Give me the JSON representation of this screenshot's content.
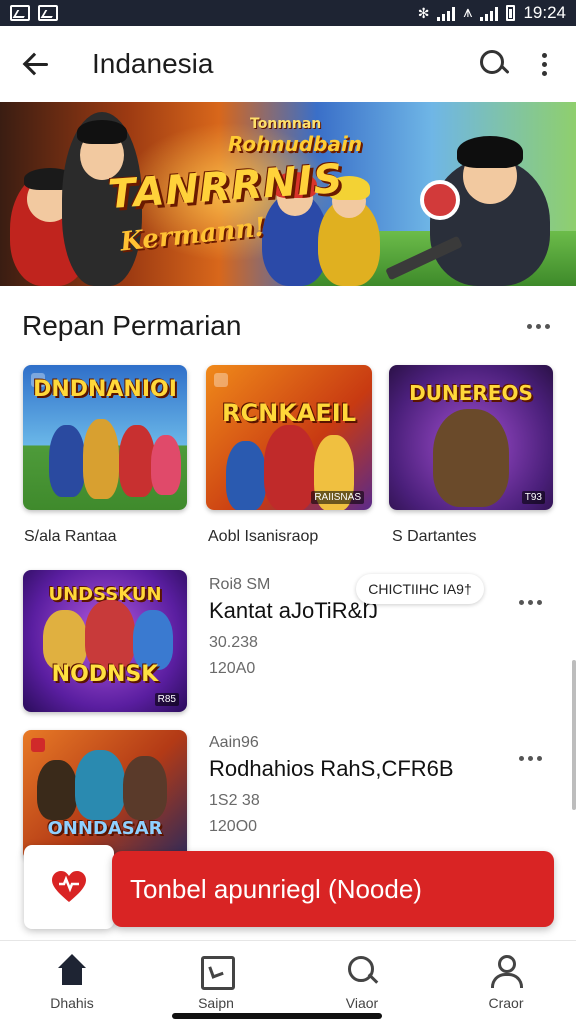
{
  "status_bar": {
    "time": "19:24"
  },
  "app_bar": {
    "title": "Indanesia"
  },
  "banner": {
    "line1": "Tonmnan",
    "line2": "Rohnudbain",
    "title": "TANRRNIS",
    "subtitle": "Kermann!"
  },
  "section": {
    "title": "Repan Permarian"
  },
  "grid": [
    {
      "thumb_title": "DNDNANIOI",
      "caption": "S/ala Rantaa"
    },
    {
      "thumb_title": "RCNKAEIL",
      "caption": "Aobl Isanisraop",
      "badge": "RAIISNAS"
    },
    {
      "thumb_title": "DUNEREOS",
      "caption": "S Dartantes",
      "badge": "T93"
    }
  ],
  "list": [
    {
      "thumb_title": "UNDSSKUN",
      "thumb_sub": "NODNSK",
      "meta": "Roi8 SM",
      "title": "Kantat aJoTiR&Ŋ",
      "num1": "30.238",
      "num2": "120A0",
      "badge": "R85"
    },
    {
      "thumb_title": "ONNDASAR",
      "meta": "Aain96",
      "title": "Rodhahios RahS,CFR6B",
      "num1": "1S2 38",
      "num2": "120O0"
    }
  ],
  "pill": {
    "label": "CHICTIIHC IA9†"
  },
  "cta": {
    "label": "Tonbel apunriegl (Noode)"
  },
  "bottom_nav": [
    {
      "label": "Dhahis",
      "icon": "home-icon"
    },
    {
      "label": "Saipn",
      "icon": "square-icon"
    },
    {
      "label": "Viaor",
      "icon": "search-icon"
    },
    {
      "label": "Craor",
      "icon": "user-icon"
    }
  ],
  "colors": {
    "accent": "#d92424",
    "statusbar": "#1e2433"
  }
}
